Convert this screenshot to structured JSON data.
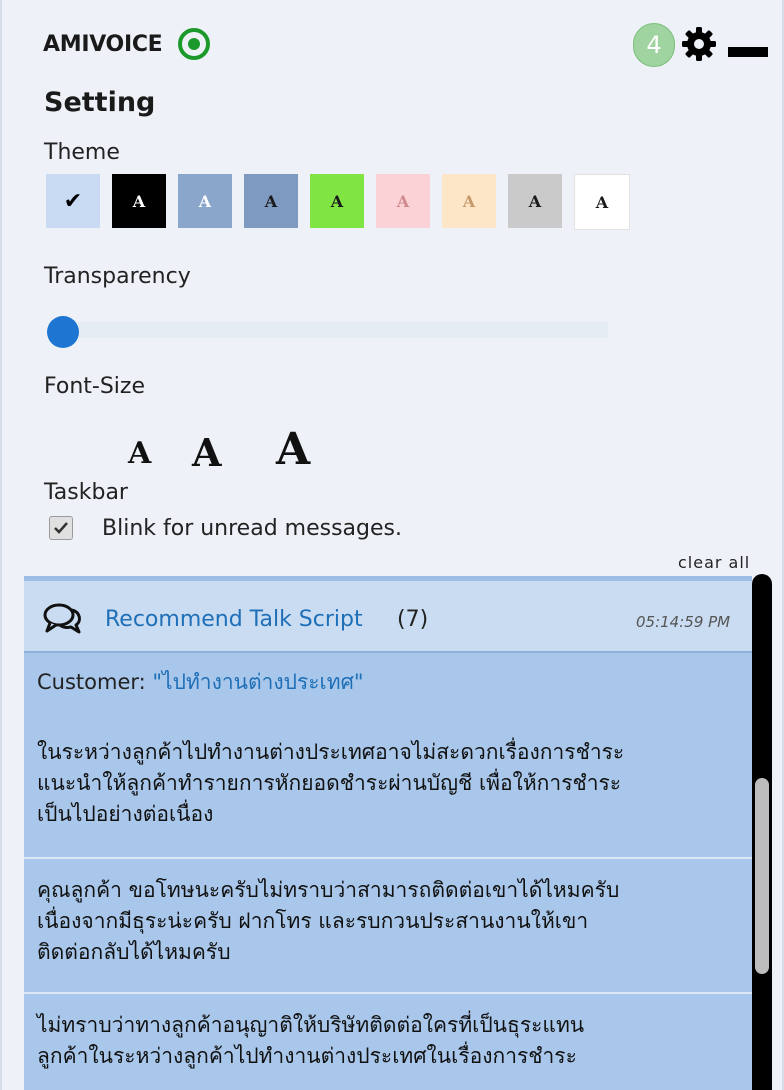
{
  "header": {
    "app_name": "AMIVOICE",
    "notification_count": "4"
  },
  "settings": {
    "title": "Setting",
    "theme_label": "Theme",
    "themes": [
      {
        "bg": "#c9dbf2",
        "fg": "#000000",
        "selected": true,
        "glyph": "✔"
      },
      {
        "bg": "#000000",
        "fg": "#ffffff",
        "glyph": "A"
      },
      {
        "bg": "#8aa6cb",
        "fg": "#ffffff",
        "glyph": "A"
      },
      {
        "bg": "#7f9ac1",
        "fg": "#1a1a1a",
        "glyph": "A"
      },
      {
        "bg": "#80e442",
        "fg": "#1a1a1a",
        "glyph": "A"
      },
      {
        "bg": "#fbd3d6",
        "fg": "#d08a8f",
        "glyph": "A"
      },
      {
        "bg": "#fde6c8",
        "fg": "#c69a6a",
        "glyph": "A"
      },
      {
        "bg": "#cacaca",
        "fg": "#1a1a1a",
        "glyph": "A"
      },
      {
        "bg": "#ffffff",
        "fg": "#1a1a1a",
        "glyph": "A"
      }
    ],
    "transparency_label": "Transparency",
    "font_size_label": "Font-Size",
    "font_size_glyph": "A",
    "taskbar_label": "Taskbar",
    "blink_label": "Blink for unread messages.",
    "blink_checked": true
  },
  "messages_panel": {
    "clear_all_label": "clear all",
    "title": "Recommend Talk Script",
    "count": "(7)",
    "time": "05:14:59 PM",
    "customer_prefix": "Customer: ",
    "customer_quote": "\"ไปทำงานต่างประเทศ\"",
    "scripts": [
      {
        "lines": [
          "ในระหว่างลูกค้าไปทำงานต่างประเทศอาจไม่สะดวกเรื่องการชำระ",
          "แนะนำให้ลูกค้าทำรายการหักยอดชำระผ่านบัญชี เพื่อให้การชำระ",
          "เป็นไปอย่างต่อเนื่อง"
        ]
      },
      {
        "lines": [
          "คุณลูกค้า ขอโทษนะครับไม่ทราบว่าสามารถติดต่อเขาได้ไหมครับ",
          "เนื่องจากมีธุระน่ะครับ ฝากโทร และรบกวนประสานงานให้เขา",
          "ติดต่อกลับได้ไหมครับ"
        ]
      },
      {
        "lines": [
          "ไม่ทราบว่าทางลูกค้าอนุญาติให้บริษัทติดต่อใครที่เป็นธุระแทน",
          "ลูกค้าในระหว่างลูกค้าไปทำงานต่างประเทศในเรื่องการชำระ"
        ]
      }
    ]
  },
  "colors": {
    "accent": "#1e76d2",
    "link": "#1e6fb8",
    "badge": "#9fd39f",
    "status_green": "#1b9a2b",
    "panel_bg": "#a9c7ea",
    "panel_header_bg": "#c9dcf1"
  },
  "icons": {
    "status": "radio-target-icon",
    "settings": "gear-icon",
    "minimize": "minimize-icon",
    "chat": "chat-bubbles-icon",
    "checkbox": "checkmark-icon"
  }
}
